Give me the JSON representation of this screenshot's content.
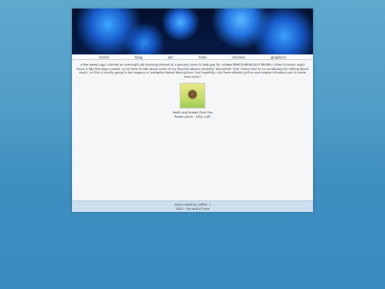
{
  "header": {
    "image": "jellyfish banner"
  },
  "nav": {
    "items": [
      {
        "label": "home"
      },
      {
        "label": "blog"
      },
      {
        "label": "art"
      },
      {
        "label": "links"
      },
      {
        "label": "shrines"
      },
      {
        "label": "graphics"
      }
    ]
  },
  "post": {
    "intro": "a few weeks ago i started an overnight job stocking shelves at a grocery store to help pay for college WHICH BASICALLY MEANS i listen to music eight hours a day five days a week, so im here to talk about some of my favorite albums recently! disclaimer: that i have next to no vocabulary for talking about music, so this is mostly going to be imagery or metaphor-based descriptions, but hopefully i do these albums justice and maybe introduce you to some new music!",
    "albums": [
      {
        "caption": "beats and breaks from the flower patch - kitty craft"
      }
    ]
  },
  "footer": {
    "lines": [
      "hand coded by catfish :)",
      "2024 - the end of time"
    ]
  }
}
